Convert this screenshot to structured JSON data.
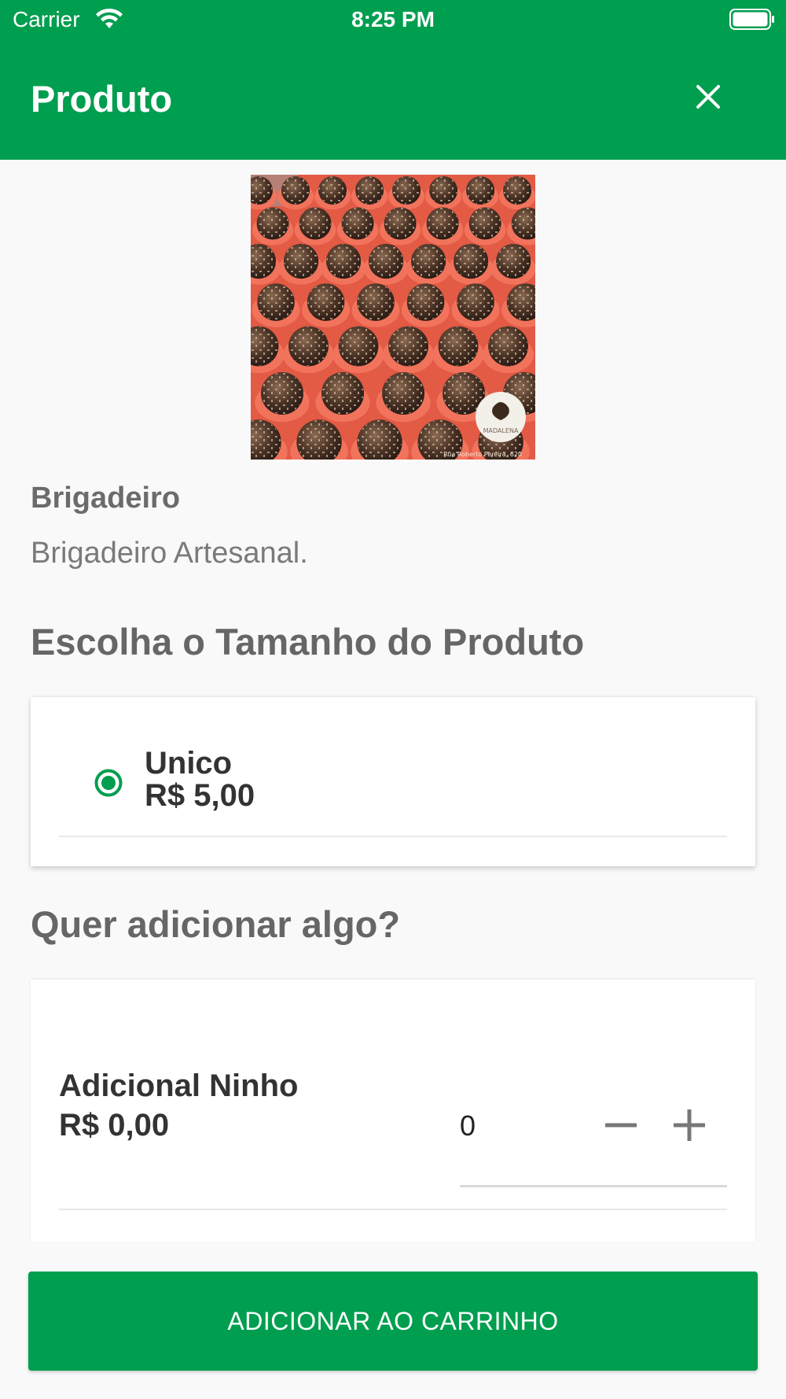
{
  "status_bar": {
    "carrier": "Carrier",
    "time": "8:25 PM",
    "icons": [
      "wifi-icon",
      "battery-icon"
    ]
  },
  "app_bar": {
    "title": "Produto",
    "close_icon": "close-icon",
    "color": "#009e4f"
  },
  "product": {
    "name": "Brigadeiro",
    "description": "Brigadeiro Artesanal.",
    "image": "photo of brigadeiros in red paper cups",
    "logo_text": "MADALENA",
    "image_caption": "Rua Roberto Pereira, 620"
  },
  "size_section": {
    "title": "Escolha o Tamanho do Produto",
    "options": [
      {
        "name": "Unico",
        "price": "R$ 5,00",
        "selected": true
      }
    ]
  },
  "addons_section": {
    "title": "Quer adicionar algo?",
    "items": [
      {
        "name": "Adicional Ninho",
        "price": "R$ 0,00",
        "quantity": "0"
      }
    ]
  },
  "footer": {
    "add_to_cart_label": "ADICIONAR AO CARRINHO"
  },
  "colors": {
    "accent": "#009e4f",
    "background": "#f9f9f9"
  }
}
